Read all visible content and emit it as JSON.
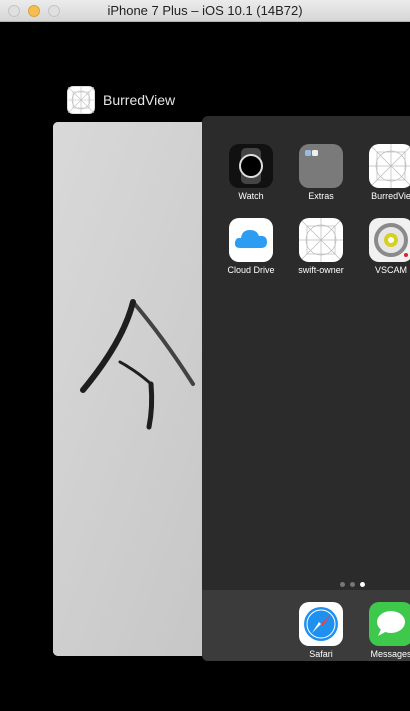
{
  "window": {
    "title": "iPhone 7 Plus – iOS 10.1 (14B72)"
  },
  "switcher": {
    "app_label": "BurredView"
  },
  "home": {
    "apps": [
      {
        "label": "Watch",
        "icon": "watch-icon"
      },
      {
        "label": "Extras",
        "icon": "folder-icon"
      },
      {
        "label": "BurredVie",
        "icon": "grid-placeholder-icon"
      },
      {
        "label": "Cloud Drive",
        "icon": "icloud-icon"
      },
      {
        "label": "swift-owner",
        "icon": "grid-placeholder-icon"
      },
      {
        "label": "VSCAM",
        "icon": "vscam-icon"
      }
    ],
    "page_count": 3,
    "active_page": 3,
    "dock": [
      {
        "label": "Safari",
        "icon": "safari-icon"
      },
      {
        "label": "Messages",
        "icon": "messages-icon"
      }
    ]
  },
  "colors": {
    "background": "#000000",
    "home_bg": "#2b2b2b",
    "dock_bg": "#3b3b3b",
    "icloud_blue": "#2d9df4",
    "messages_green": "#3ec94d"
  }
}
